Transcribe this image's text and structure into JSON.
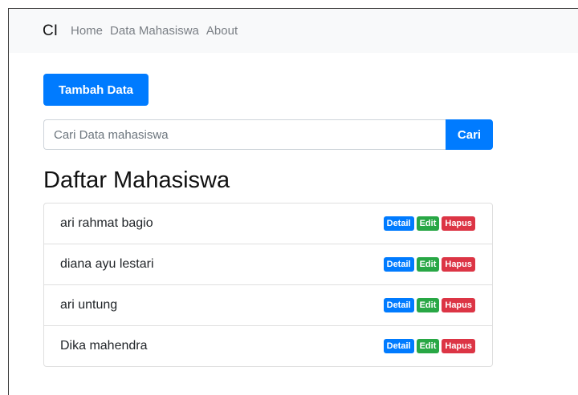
{
  "navbar": {
    "brand": "CI",
    "links": [
      "Home",
      "Data Mahasiswa",
      "About"
    ]
  },
  "actions": {
    "add_label": "Tambah Data"
  },
  "search": {
    "placeholder": "Cari Data mahasiswa",
    "value": "",
    "button_label": "Cari"
  },
  "main": {
    "title": "Daftar Mahasiswa",
    "students": [
      {
        "name": "ari rahmat bagio"
      },
      {
        "name": "diana ayu lestari"
      },
      {
        "name": "ari untung"
      },
      {
        "name": "Dika mahendra"
      }
    ],
    "badges": {
      "detail": "Detail",
      "edit": "Edit",
      "delete": "Hapus"
    }
  },
  "colors": {
    "primary": "#007bff",
    "success": "#28a745",
    "danger": "#dc3545",
    "navbar_bg": "#f8f9fa"
  }
}
